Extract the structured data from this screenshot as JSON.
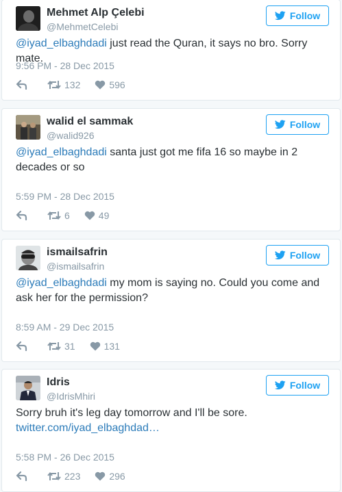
{
  "follow_label": "Follow",
  "colors": {
    "accent": "#1da1f2",
    "link": "#2b7bb9",
    "muted": "#8899a6",
    "text": "#292f33"
  },
  "icons": {
    "reply": "reply-icon",
    "retweet": "retweet-icon",
    "like": "heart-icon",
    "follow": "twitter-bird-icon"
  },
  "tweets": [
    {
      "name": "Mehmet Alp Çelebi",
      "handle": "@MehmetCelebi",
      "mention": "@iyad_elbaghdadi",
      "text": " just read the Quran, it says no bro. Sorry mate.",
      "time": "9:56 PM - 28 Dec 2015",
      "retweets": "132",
      "likes": "596"
    },
    {
      "name": "walid el sammak",
      "handle": "@walid926",
      "mention": "@iyad_elbaghdadi",
      "text": " santa just got me fifa 16 so maybe in 2 decades or so",
      "time": "5:59 PM - 28 Dec 2015",
      "retweets": "6",
      "likes": "49"
    },
    {
      "name": "ismailsafrin",
      "handle": "@ismailsafrin",
      "mention": "@iyad_elbaghdadi",
      "text": " my mom is saying no. Could you come and ask her for the permission?",
      "time": "8:59 AM - 29 Dec 2015",
      "retweets": "31",
      "likes": "131"
    },
    {
      "name": "Idris",
      "handle": "@IdrisMhiri",
      "text": "Sorry bruh it's leg day tomorrow and I'll be sore.",
      "link": "twitter.com/iyad_elbaghdad…",
      "time": "5:58 PM - 26 Dec 2015",
      "retweets": "223",
      "likes": "296"
    }
  ]
}
